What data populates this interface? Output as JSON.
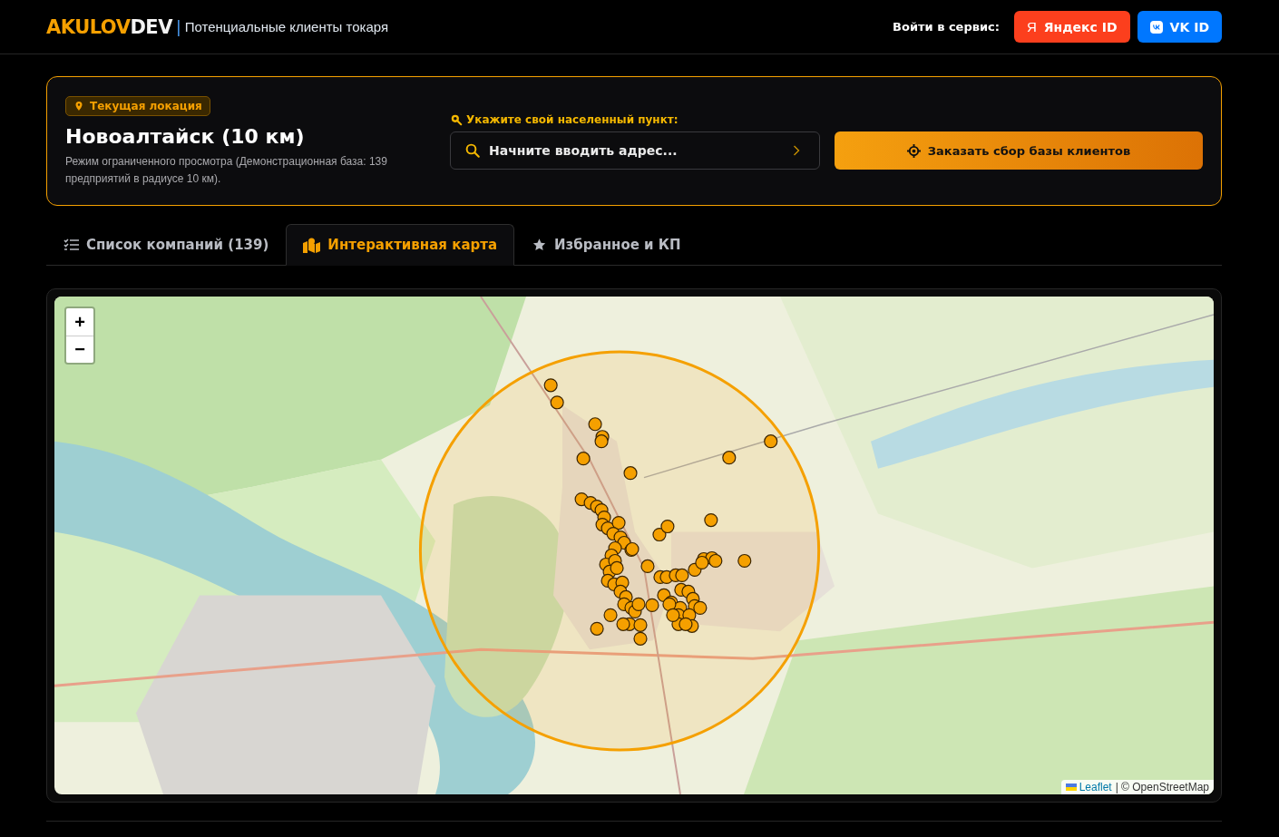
{
  "header": {
    "logo": {
      "accent": "AKULOV",
      "rest": "DEV"
    },
    "separator": "|",
    "subtitle": "Потенциальные клиенты токаря",
    "login_label": "Войти в сервис:",
    "login_buttons": [
      {
        "kind": "yandex",
        "icon_text": "Я",
        "label": "Яндекс ID"
      },
      {
        "kind": "vk",
        "label": "VK ID"
      }
    ]
  },
  "location": {
    "badge": "Текущая локация",
    "title": "Новоалтайск (10 км)",
    "description": "Режим ограниченного просмотра (Демонстрационная база: 139 предприятий в радиусе 10 км).",
    "search_label": "Укажите свой населенный пункт:",
    "search_placeholder": "Начните вводить адрес...",
    "order_button": "Заказать сбор базы клиентов"
  },
  "tabs": [
    {
      "kind": "list",
      "label": "Список компаний (139)",
      "selected": false
    },
    {
      "kind": "map",
      "label": "Интерактивная карта",
      "selected": true
    },
    {
      "kind": "star",
      "label": "Избранное и КП",
      "selected": false
    }
  ],
  "map": {
    "zoom_in": "+",
    "zoom_out": "−",
    "attribution": {
      "link": "Leaflet",
      "rest": "| © OpenStreetMap"
    }
  }
}
